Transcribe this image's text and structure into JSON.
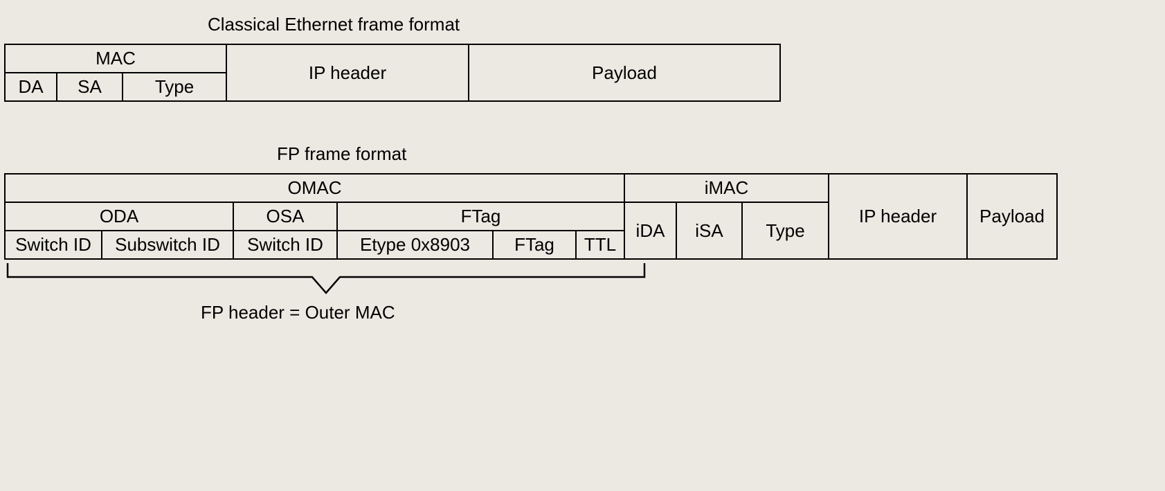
{
  "classical": {
    "title": "Classical Ethernet frame format",
    "mac": "MAC",
    "da": "DA",
    "sa": "SA",
    "type": "Type",
    "ip_header": "IP header",
    "payload": "Payload"
  },
  "fp": {
    "title": "FP frame format",
    "omac": "OMAC",
    "imac": "iMAC",
    "ip_header": "IP header",
    "payload": "Payload",
    "oda": "ODA",
    "osa": "OSA",
    "ftag_group": "FTag",
    "ida": "iDA",
    "isa": "iSA",
    "type": "Type",
    "switch_id_1": "Switch ID",
    "subswitch_id": "Subswitch ID",
    "switch_id_2": "Switch ID",
    "etype": "Etype 0x8903",
    "ftag": "FTag",
    "ttl": "TTL",
    "caption": "FP header = Outer MAC"
  }
}
